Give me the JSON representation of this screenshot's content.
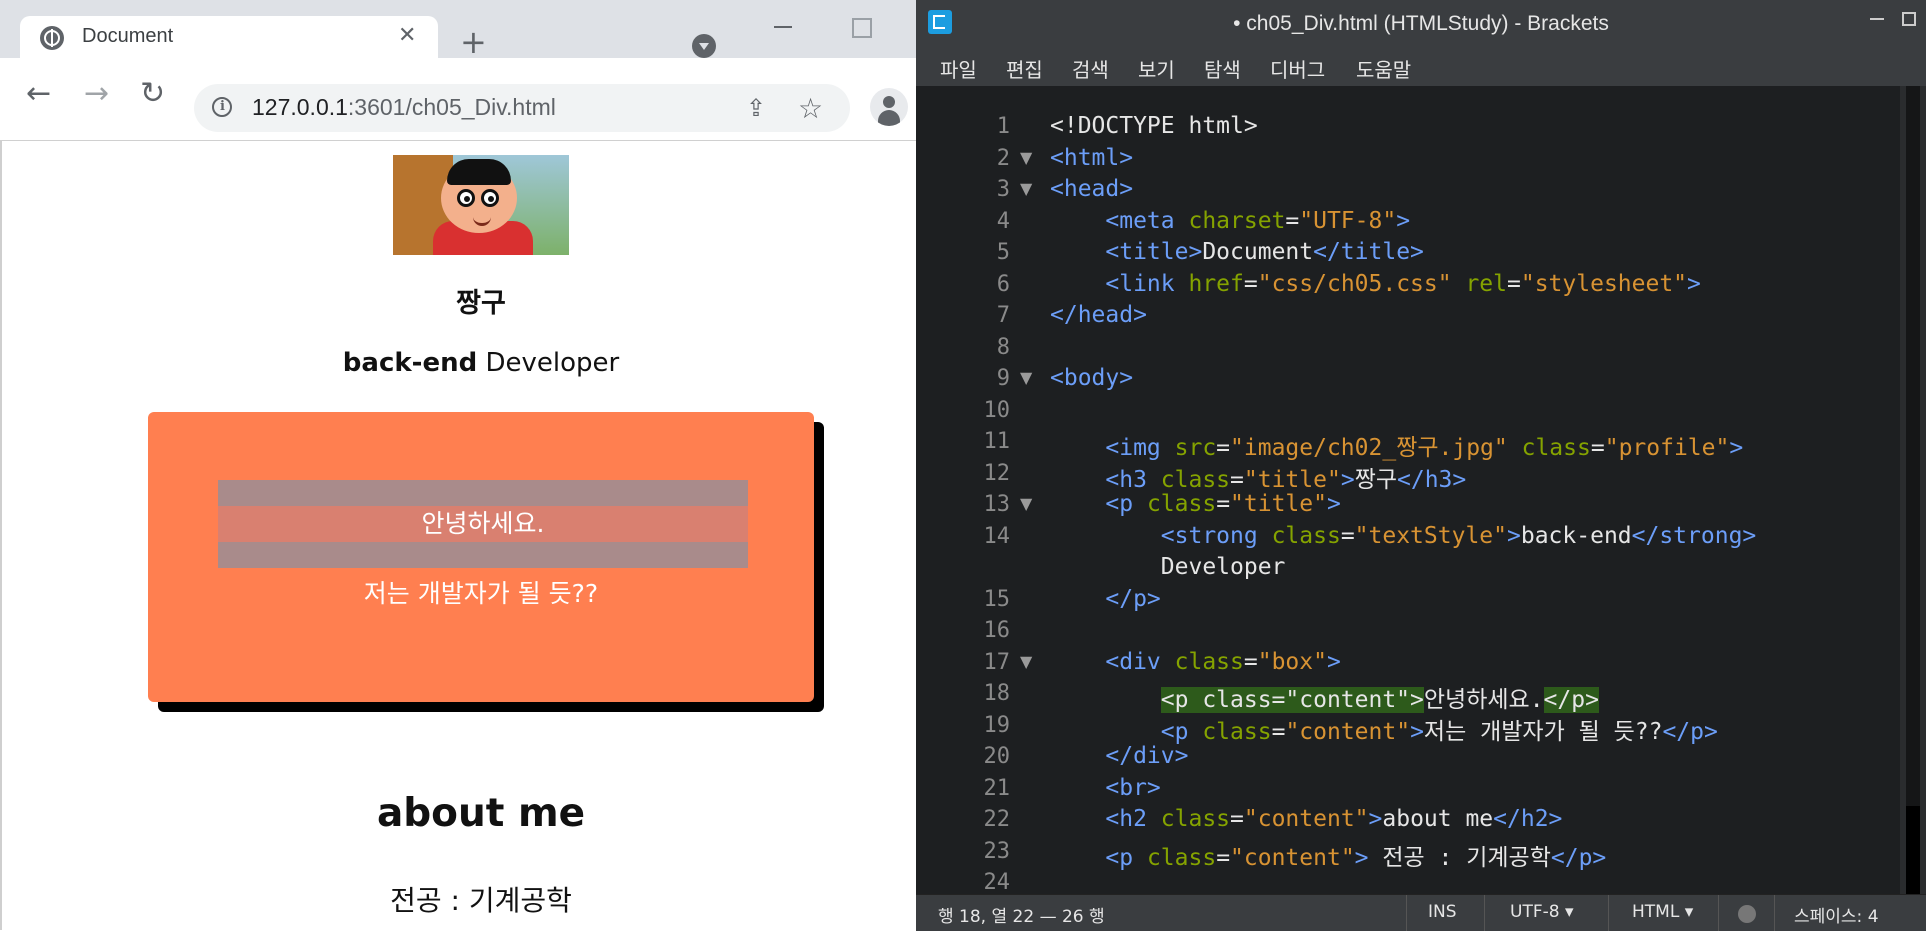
{
  "browser": {
    "tab_title": "Document",
    "tab_close": "✕",
    "new_tab": "+",
    "url_host": "127.0.0.1",
    "url_rest": ":3601/ch05_Div.html",
    "back": "←",
    "forward": "→",
    "reload": "↻",
    "share": "⇪",
    "star": "☆"
  },
  "page": {
    "title": "짱구",
    "role_strong": "back-end",
    "role_rest": " Developer",
    "greeting": "안녕하세요.",
    "intro": "저는 개발자가 될 듯??",
    "about_heading": "about me",
    "major": "전공 : 기계공학"
  },
  "editor": {
    "window_title": "• ch05_Div.html (HTMLStudy) - Brackets",
    "menu": [
      "파일",
      "편집",
      "검색",
      "보기",
      "탐색",
      "디버그",
      "도움말"
    ],
    "line_numbers": [
      "1",
      "2",
      "3",
      "4",
      "5",
      "6",
      "7",
      "8",
      "9",
      "10",
      "11",
      "12",
      "13",
      "14",
      "",
      "15",
      "16",
      "17",
      "18",
      "19",
      "20",
      "21",
      "22",
      "23",
      "24"
    ],
    "fold_markers": [
      "",
      "▼",
      "▼",
      "",
      "",
      "",
      "",
      "",
      "▼",
      "",
      "",
      "",
      "▼",
      "",
      "",
      "",
      "",
      "▼",
      "",
      "",
      "",
      "",
      "",
      "",
      ""
    ],
    "code": {
      "l1": "<!DOCTYPE html>",
      "l2": "<html>",
      "l3": "<head>",
      "l4_tag": "    <meta",
      "l4_attr": " charset",
      "l4_eq": "=",
      "l4_val": "\"UTF-8\"",
      "l4_end": ">",
      "l5_open": "    <title>",
      "l5_text": "Document",
      "l5_close": "</title>",
      "l6_tag": "    <link",
      "l6_a1": " href",
      "l6_eq1": "=",
      "l6_v1": "\"css/ch05.css\"",
      "l6_a2": " rel",
      "l6_eq2": "=",
      "l6_v2": "\"stylesheet\"",
      "l6_end": ">",
      "l7": "</head>",
      "l9": "<body>",
      "l11_tag": "    <img",
      "l11_a1": " src",
      "l11_eq1": "=",
      "l11_v1": "\"image/ch02_짱구.jpg\"",
      "l11_a2": " class",
      "l11_eq2": "=",
      "l11_v2": "\"profile\"",
      "l11_end": ">",
      "l12_tag": "    <h3",
      "l12_a": " class",
      "l12_eq": "=",
      "l12_v": "\"title\"",
      "l12_gt": ">",
      "l12_text": "짱구",
      "l12_close": "</h3>",
      "l13_tag": "    <p",
      "l13_a": " class",
      "l13_eq": "=",
      "l13_v": "\"title\"",
      "l13_end": ">",
      "l14_tag": "        <strong",
      "l14_a": " class",
      "l14_eq": "=",
      "l14_v": "\"textStyle\"",
      "l14_gt": ">",
      "l14_text": "back-end",
      "l14_close": "</strong>",
      "l14b": "        Developer",
      "l15": "    </p>",
      "l17_tag": "    <div",
      "l17_a": " class",
      "l17_eq": "=",
      "l17_v": "\"box\"",
      "l17_end": ">",
      "l18_open": "<p class=\"content\">",
      "l18_text": "안녕하세요.",
      "l18_close": "</p>",
      "l19_tag": "        <p",
      "l19_a": " class",
      "l19_eq": "=",
      "l19_v": "\"content\"",
      "l19_gt": ">",
      "l19_text": "저는 개발자가 될 듯??",
      "l19_close": "</p>",
      "l20": "    </div>",
      "l21": "    <br>",
      "l22_tag": "    <h2",
      "l22_a": " class",
      "l22_eq": "=",
      "l22_v": "\"content\"",
      "l22_gt": ">",
      "l22_text": "about me",
      "l22_close": "</h2>",
      "l23_tag": "    <p",
      "l23_a": " class",
      "l23_eq": "=",
      "l23_v": "\"content\"",
      "l23_gt": ">",
      "l23_text": " 전공 : 기계공학",
      "l23_close": "</p>"
    },
    "status": {
      "cursor": "행 18, 열 22 — 26 행",
      "mode": "INS",
      "encoding": "UTF-8 ▾",
      "language": "HTML ▾",
      "spaces": "스페이스: 4"
    }
  },
  "colors": {
    "box": "#ff7f50",
    "tag": "#6c9ef8",
    "attr": "#85a300",
    "value": "#d89333",
    "editor_bg": "#1d1f21"
  }
}
